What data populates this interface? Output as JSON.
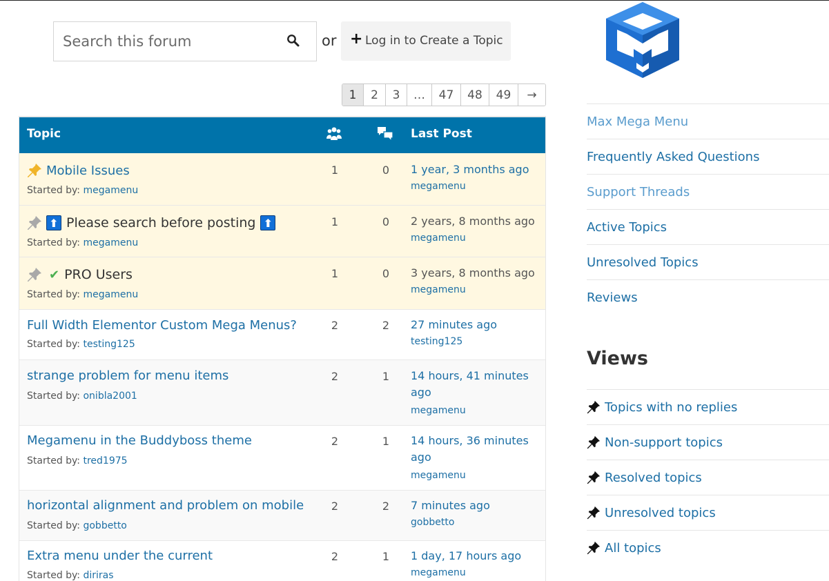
{
  "search": {
    "placeholder": "Search this forum"
  },
  "or_label": "or",
  "login_button": {
    "plus": "+",
    "label": "Log in to Create a Topic"
  },
  "pagination": [
    "1",
    "2",
    "3",
    "…",
    "47",
    "48",
    "49",
    "→"
  ],
  "table": {
    "header_topic": "Topic",
    "header_voices_icon": "users-icon",
    "header_posts_icon": "comments-icon",
    "header_last_post": "Last Post"
  },
  "started_by_label": "Started by:",
  "topics": [
    {
      "title": "Mobile Issues",
      "author": "megamenu",
      "voices": "1",
      "posts": "0",
      "time": "1 year, 3 months ago",
      "last_by": "megamenu"
    },
    {
      "title_prefix": "⬆",
      "title": "Please search before posting",
      "title_suffix": "⬆",
      "author": "megamenu",
      "voices": "1",
      "posts": "0",
      "time": "2 years, 8 months ago",
      "last_by": "megamenu"
    },
    {
      "title_prefix": "✔",
      "title": "PRO Users",
      "author": "megamenu",
      "voices": "1",
      "posts": "0",
      "time": "3 years, 8 months ago",
      "last_by": "megamenu"
    },
    {
      "title": "Full Width Elementor Custom Mega Menus?",
      "author": "testing125",
      "voices": "2",
      "posts": "2",
      "time": "27 minutes ago",
      "last_by": "testing125"
    },
    {
      "title": "strange problem for menu items",
      "author": "onibla2001",
      "voices": "2",
      "posts": "1",
      "time": "14 hours, 41 minutes ago",
      "last_by": "megamenu"
    },
    {
      "title": "Megamenu in the Buddyboss theme",
      "author": "tred1975",
      "voices": "2",
      "posts": "1",
      "time": "14 hours, 36 minutes ago",
      "last_by": "megamenu"
    },
    {
      "title": "horizontal alignment and problem on mobile",
      "author": "gobbetto",
      "voices": "2",
      "posts": "2",
      "time": "7 minutes ago",
      "last_by": "gobbetto"
    },
    {
      "title": "Extra menu under the current",
      "author": "diriras",
      "voices": "2",
      "posts": "1",
      "time": "1 day, 17 hours ago",
      "last_by": "megamenu"
    }
  ],
  "sidebar": {
    "links": [
      "Max Mega Menu",
      "Frequently Asked Questions",
      "Support Threads",
      "Active Topics",
      "Unresolved Topics",
      "Reviews"
    ],
    "views_title": "Views",
    "views": [
      "Topics with no replies",
      "Non-support topics",
      "Resolved topics",
      "Unresolved topics",
      "All topics"
    ]
  },
  "colors": {
    "header_blue": "#0073aa",
    "link": "#1d6fa5",
    "sticky_bg": "#fff8e1",
    "logo_blue": "#1e6fd1"
  }
}
